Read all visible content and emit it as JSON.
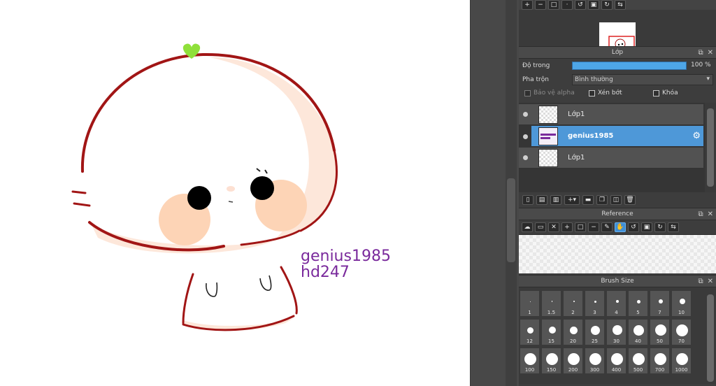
{
  "canvas": {
    "watermark_line1": "genius1985",
    "watermark_line2": "hd247",
    "colors": {
      "outline": "#a11515",
      "skin": "#fde7da",
      "blush": "#fdd4b6",
      "leaf": "#8fe03a",
      "eyes": "#000000",
      "watermark": "#7a2a9c"
    }
  },
  "navigator": {
    "toolbar_icons": [
      "zoom-in-icon",
      "zoom-out-icon",
      "fit-icon",
      "zoom-reset-icon",
      "rotate-left-icon",
      "fit-window-icon",
      "rotate-right-icon",
      "flip-icon"
    ]
  },
  "layer_panel": {
    "title": "Lớp",
    "opacity_label": "Độ trong",
    "opacity_value": "100 %",
    "opacity_fraction": 1.0,
    "blend_label": "Pha trộn",
    "blend_value": "Bình thường",
    "protect_alpha": "Bảo vệ alpha",
    "clipping": "Xén bớt",
    "lock": "Khóa",
    "layers": [
      {
        "name": "Lớp1",
        "selected": false
      },
      {
        "name": "genius1985",
        "selected": true
      },
      {
        "name": "Lớp1",
        "selected": false
      }
    ]
  },
  "reference_panel": {
    "title": "Reference"
  },
  "brush_panel": {
    "title": "Brush Size",
    "sizes": [
      "1",
      "1.5",
      "2",
      "3",
      "4",
      "5",
      "7",
      "10",
      "12",
      "15",
      "20",
      "25",
      "30",
      "40",
      "50",
      "70",
      "100",
      "150",
      "200",
      "300",
      "400",
      "500",
      "700",
      "1000"
    ]
  }
}
